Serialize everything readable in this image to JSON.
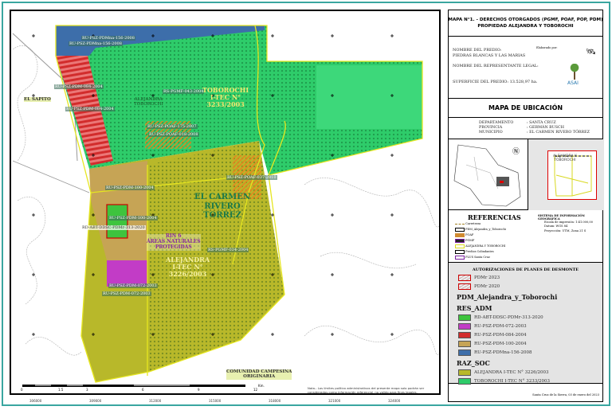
{
  "map": {
    "labels": {
      "toborochi": "TOBOROCHI\nI-TEC N°\n3233/2003",
      "alejandra": "ALEJANDRA\nI-TEC N°\n3226/2003",
      "carmen": "EL CARMEN\nRIVERO\nTORREZ",
      "rin": "RIN 6\nÁREAS NATURALES\nPROTEGIDAS",
      "sapito": "EL SAPITO",
      "comunidad": "COMUNIDAD CAMPESINA\nORIGINARIA",
      "alej_tob": "ALEJANDRA\nTOBOROCHI",
      "blue1": "RU-PSZ-PDMna-156-2008",
      "blue2": "RU-PSZ-PDMna-156-2008",
      "red1": "RU-PSZ-PDM-084-2004",
      "red2": "RU-PSZ-PDM-084-2004",
      "pgmf1": "RS-PGMF-043-2004",
      "poaf1": "RU-PSZ-POAF-175-2007",
      "poaf2": "RU-PSZ-POAF-018-2008",
      "poaf3": "RU-PSZ-POAF-037-2010",
      "tan1": "RU-PSZ-PDM-100-2004",
      "tan2": "RU-PSZ-PDM-100-2004",
      "rdabt": "RD-ABT-DDSC-PDMr-313-2020",
      "pgmf2": "RS-PGMF-034-2004",
      "pur1": "RU-PSZ-PDM-072-2003",
      "pur2": "RU-PSZ-PDM-072-2003"
    },
    "scale": {
      "ticks": [
        "0",
        "1.5",
        "3",
        "6",
        "9",
        "12"
      ],
      "unit": "Km."
    },
    "x_ticks": [
      "306000",
      "309000",
      "312000",
      "315000",
      "318000",
      "321000",
      "324000"
    ],
    "note": "Nota.- Los límites político administrativos del presente mapa solo podrán ser considerados como información referencial, no valido para fines legales."
  },
  "panel": {
    "title": "MAPA N°1. - DERECHOS OTORGADOS (PGMF, POAF, POP, PDM)\nPROPIEDAD ALEJANDRA Y TOBOROCHI",
    "predio_label": "NOMBRE DEL PREDIO:",
    "predio_value": "PIEDRAS BLANCAS Y LAS MARIAS",
    "rep_label": "NOMBRE DEL REPRESENTANTE LEGAL:",
    "sup": "SUPERFICIE DEL PREDIO: 13.528,97 ha.",
    "elaborado": "Elaborado por:",
    "logo": "ASAI",
    "ubic_title": "MAPA DE UBICACIÓN",
    "dept_k": "DEPARTAMENTO",
    "dept_v": ": SANTA CRUZ",
    "prov_k": "PROVINCIA",
    "prov_v": ": GERMÁN BUSCH",
    "mun_k": "MUNICIPIO",
    "mun_v": ": EL CARMEN RIVERO TÓRREZ",
    "inset_label": "ALEJANDRA Y\nTOBOROCHI",
    "ref_title": "REFERENCIAS",
    "refs": [
      "Carreteras",
      "PDM_Alejandra_y_Toborochi",
      "POAF",
      "PGMF",
      "ALEJANDRA Y TOBOROCHI",
      "Predios Colindantes",
      "PLUS Santa Cruz"
    ],
    "sig_title": "SISTEMA DE INFORMACIÓN GEOGRÁFICA",
    "sig_escala": "Escala de impresión:   1:41.000,00",
    "sig_datum": "Datum:   WGS 84",
    "sig_proj": "Proyección:   UTM, Zona 21 S",
    "aut_title": "AUTORIZACIONES DE PLANES DE DESMONTE",
    "pdmr2023": "PDMr 2023",
    "pdmr2020": "PDMr 2020",
    "pdm_title": "PDM_Alejandra_y_Toborochi",
    "res_title": "RES_ADM",
    "res": [
      {
        "label": "RD-ABT-DDSC-PDMr-313-2020",
        "color": "#3ec43e"
      },
      {
        "label": "RU-PSZ-PDM-072-2003",
        "color": "#c23cc6"
      },
      {
        "label": "RU-PSZ-PDM-084-2004",
        "color": "#d22c2c"
      },
      {
        "label": "RU-PSZ-PDM-100-2004",
        "color": "#c6a455"
      },
      {
        "label": "RU-PSZ-PDMna-156-2008",
        "color": "#3d6eaa"
      }
    ],
    "raz_title": "RAZ_SOC",
    "raz": [
      {
        "label": "ALEJANDRA I-TEC N° 3226/2003",
        "color": "#b8b82a"
      },
      {
        "label": "TOBOROCHI I-TEC N° 3233/2003",
        "color": "#2ecc6a"
      }
    ],
    "date": "Santa Cruz de la Sierra, 03 de enero del 2023"
  }
}
